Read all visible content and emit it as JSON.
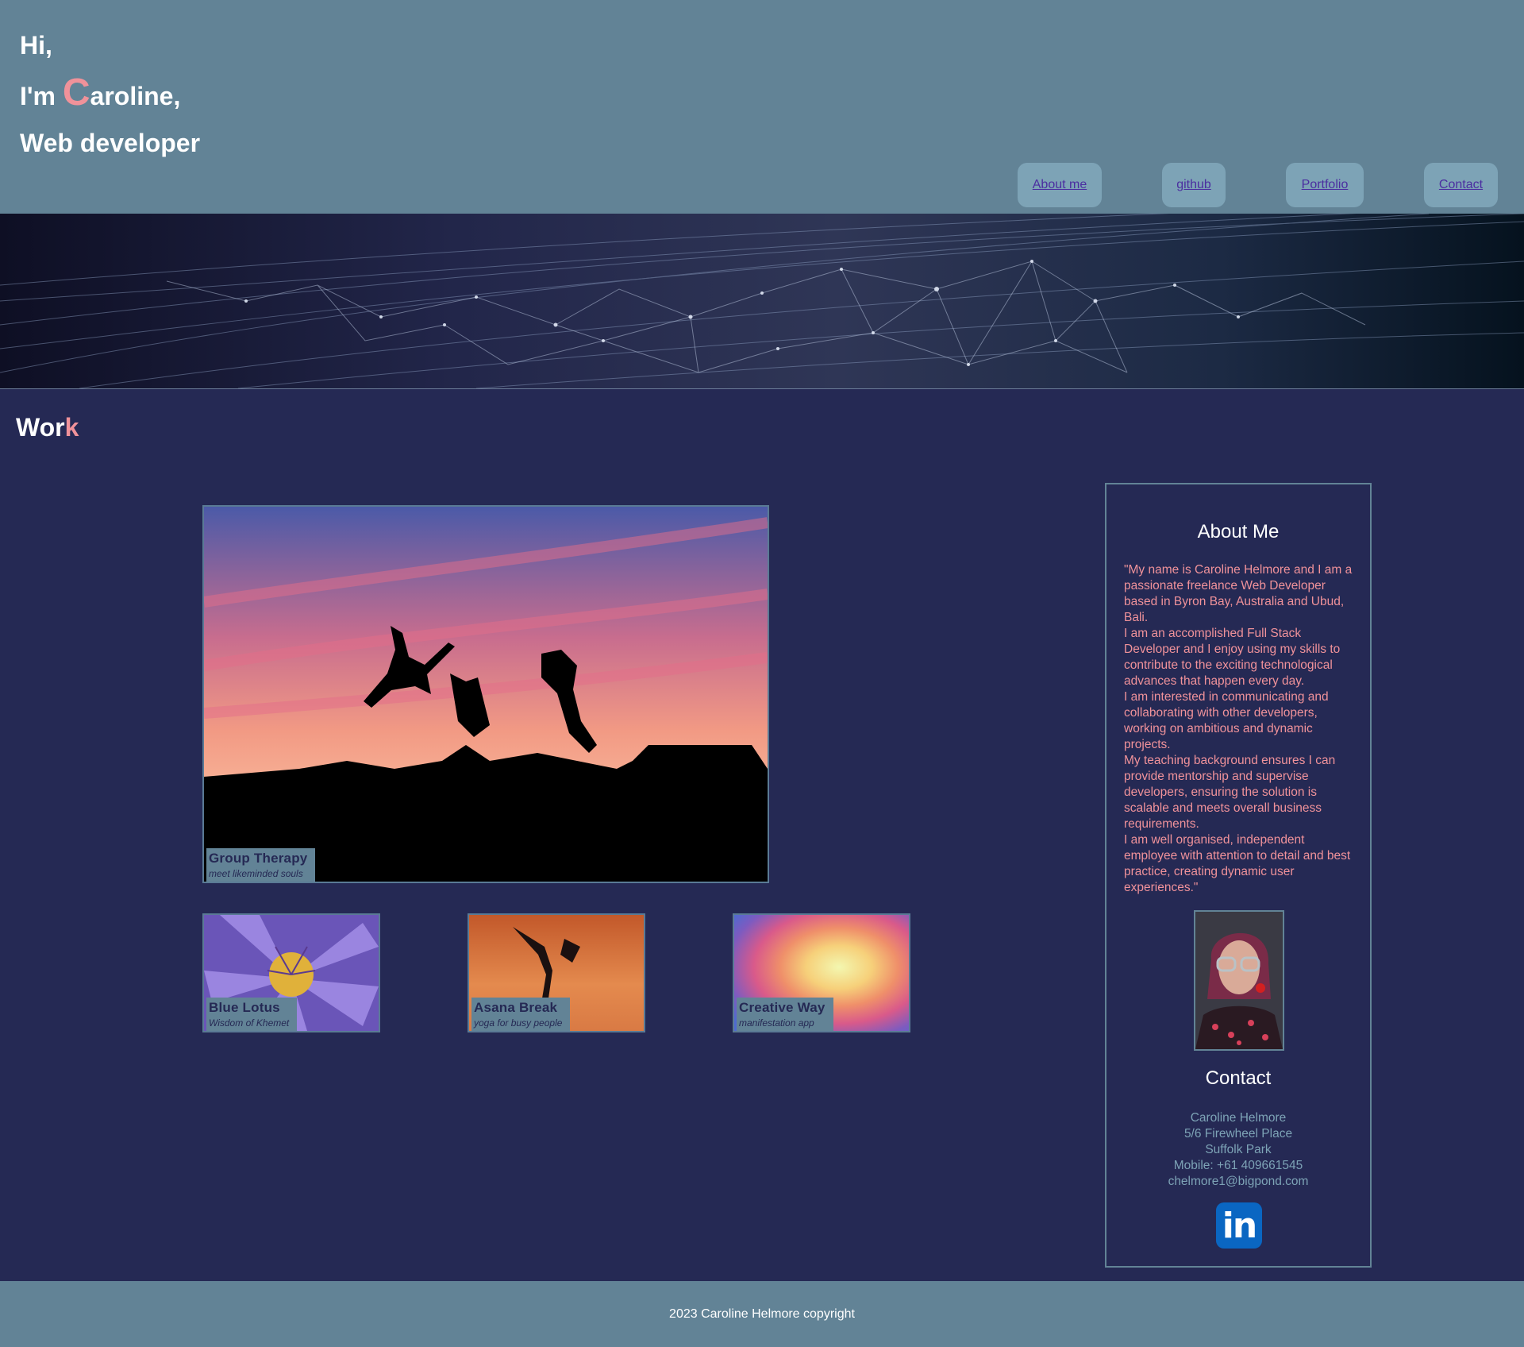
{
  "intro": {
    "line1": "Hi,",
    "line2_prefix": "I'm ",
    "line2_cap": "C",
    "line2_rest": "aroline,",
    "line3": "Web developer"
  },
  "nav": {
    "items": [
      {
        "label": "About me"
      },
      {
        "label": "github"
      },
      {
        "label": "Portfolio"
      },
      {
        "label": "Contact"
      }
    ]
  },
  "work": {
    "title_main": "Wor",
    "title_accent": "k",
    "featured": {
      "title": "Group Therapy",
      "subtitle": "meet likeminded souls"
    },
    "cards": [
      {
        "title": "Blue Lotus",
        "subtitle": "Wisdom of Khemet"
      },
      {
        "title": "Asana Break",
        "subtitle": "yoga for busy people"
      },
      {
        "title": "Creative Way",
        "subtitle": "manifestation app"
      }
    ]
  },
  "about": {
    "heading": "About Me",
    "paragraphs": [
      "\"My name is Caroline Helmore and I am a passionate freelance Web Developer based in Byron Bay, Australia and Ubud, Bali.",
      "I am an accomplished Full Stack Developer and I enjoy using my skills to contribute to the exciting technological advances that happen every day.",
      "I am interested in communicating and collaborating with other developers, working on ambitious and dynamic projects.",
      "My teaching background ensures I can provide mentorship and supervise developers, ensuring the solution is scalable and meets overall business requirements.",
      "I am well organised, independent employee with attention to detail and best practice, creating dynamic user experiences.\""
    ]
  },
  "contact": {
    "heading": "Contact",
    "name": "Caroline Helmore",
    "address1": "5/6 Firewheel Place",
    "address2": "Suffolk Park",
    "mobile": "Mobile: +61 409661545",
    "email": "chelmore1@bigpond.com",
    "linkedin_icon": "linkedin-icon",
    "linkedin_text": "in"
  },
  "footer": {
    "text": "2023 Caroline Helmore copyright"
  },
  "colors": {
    "header_bg": "#628396",
    "page_bg": "#252954",
    "accent_pink": "#f0929a",
    "link_purple": "#4b2ea0"
  }
}
